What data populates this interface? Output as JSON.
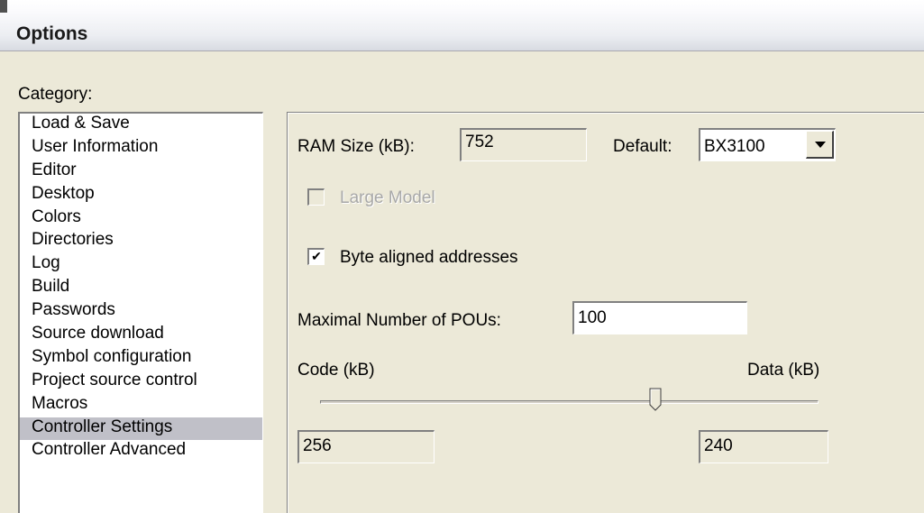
{
  "window": {
    "title": "Options"
  },
  "category": {
    "label": "Category:",
    "selected_index": 13,
    "items": [
      "Load & Save",
      "User Information",
      "Editor",
      "Desktop",
      "Colors",
      "Directories",
      "Log",
      "Build",
      "Passwords",
      "Source download",
      "Symbol configuration",
      "Project source control",
      "Macros",
      "Controller Settings",
      "Controller Advanced"
    ]
  },
  "settings": {
    "ram_size_label": "RAM Size (kB):",
    "ram_size_value": "752",
    "default_label": "Default:",
    "default_value": "BX3100",
    "large_model_label": "Large Model",
    "large_model_checked": false,
    "byte_aligned_label": "Byte aligned addresses",
    "byte_aligned_checked": true,
    "max_pous_label": "Maximal Number of POUs:",
    "max_pous_value": "100",
    "code_label": "Code (kB)",
    "data_label": "Data (kB)",
    "code_value": "256",
    "data_value": "240",
    "slider_fraction": 0.673
  }
}
